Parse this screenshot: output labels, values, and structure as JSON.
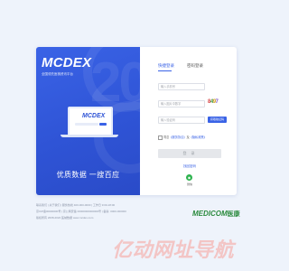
{
  "brand": {
    "logo_text": "MCDEX",
    "tagline": "全国领先医械资讯平台"
  },
  "left_panel": {
    "background_number": "20",
    "laptop_logo": "MCDEX",
    "slogan": "优质数据  一搜百应"
  },
  "login": {
    "tabs": [
      {
        "label": "快捷登录",
        "active": true
      },
      {
        "label": "密码登录",
        "active": false
      }
    ],
    "phone_placeholder": "输入手机号",
    "image_code_placeholder": "输入图片中数字",
    "captcha_text": "8497",
    "sms_code_placeholder": "输入验证码",
    "sms_button": "获取验证码",
    "agree_prefix": "同意",
    "agree_link1": "《服务协议》",
    "agree_mid": "及",
    "agree_link2": "《隐私政策》",
    "submit": "登 录",
    "forgot": "找回密码",
    "wechat_label": "微信"
  },
  "footer": {
    "line1": "联系我们  |  关于我们  |  服务热线 400-000-0000  |  工作日 9:00-18:00",
    "line2": "京ICP备00000000号  |  京公网安备 00000000000000号  |  备案: 0000-000000",
    "line3": "版权所有 2008-2022 医械数据 www.mcdex.com",
    "logo": "MEDICOM",
    "logo_cn": "医康"
  },
  "watermark": "亿动网址导航",
  "colors": {
    "accent": "#3a63e6",
    "wechat": "#2eb34f",
    "watermark": "#f3c5c5"
  }
}
